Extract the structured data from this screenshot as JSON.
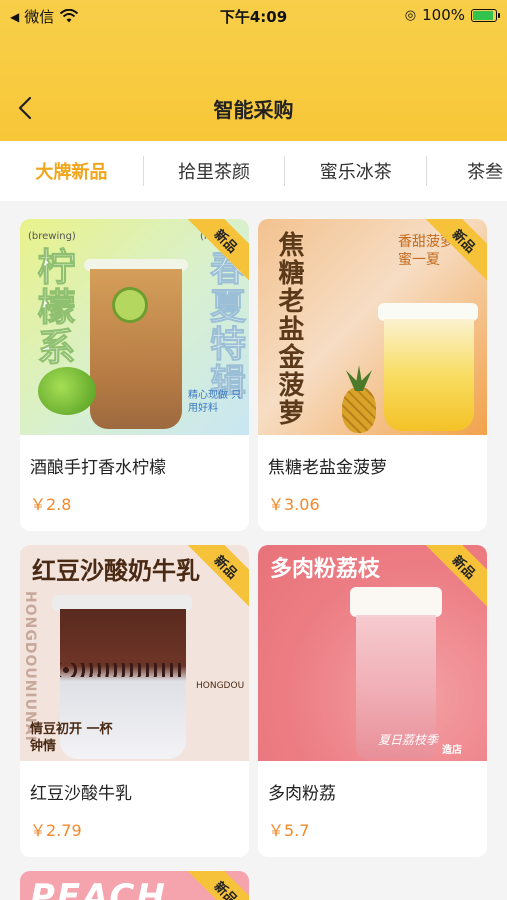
{
  "status_bar": {
    "back_app": "微信",
    "time": "下午4:09",
    "battery": "100%",
    "battery_level": 1.0
  },
  "nav": {
    "title": "智能采购",
    "back_icon": "chevron-left-icon"
  },
  "tabs": [
    {
      "label": "大牌新品",
      "active": true
    },
    {
      "label": "拾里茶颜",
      "active": false
    },
    {
      "label": "蜜乐冰茶",
      "active": false
    },
    {
      "label": "茶叁",
      "active": false
    }
  ],
  "products": [
    {
      "name": "酒酿手打香水柠檬",
      "price": "￥2.8",
      "badge": "新品",
      "art": {
        "big_text": "柠檬系",
        "side_text": "春夏特辑",
        "small_left": "(brewing)",
        "small_right": "(le",
        "note": "精心现做 只用好料"
      }
    },
    {
      "name": "焦糖老盐金菠萝",
      "price": "￥3.06",
      "badge": "新品",
      "art": {
        "big_text": "焦糖老盐金菠萝",
        "side_text": "香甜菠萝 甜蜜一夏"
      }
    },
    {
      "name": "红豆沙酸牛乳",
      "price": "￥2.79",
      "badge": "新品",
      "art": {
        "big_text": "红豆沙酸奶牛乳",
        "side_text": "HONGDOUNIUNAI",
        "note": "情豆初开 一杯钟情",
        "tag": "HONGDOU"
      }
    },
    {
      "name": "多肉粉荔",
      "price": "￥5.7",
      "badge": "新品",
      "art": {
        "big_text": "多肉粉荔枝",
        "note": "夏日荔枝季",
        "tag": "造店"
      }
    },
    {
      "name": "",
      "price": "",
      "badge": "新品",
      "art": {
        "big_text": "PEACH"
      }
    }
  ],
  "colors": {
    "header_yellow": "#f8cb40",
    "active_tab": "#f2a51a",
    "price": "#f2892a",
    "badge": "#f6c23a"
  }
}
